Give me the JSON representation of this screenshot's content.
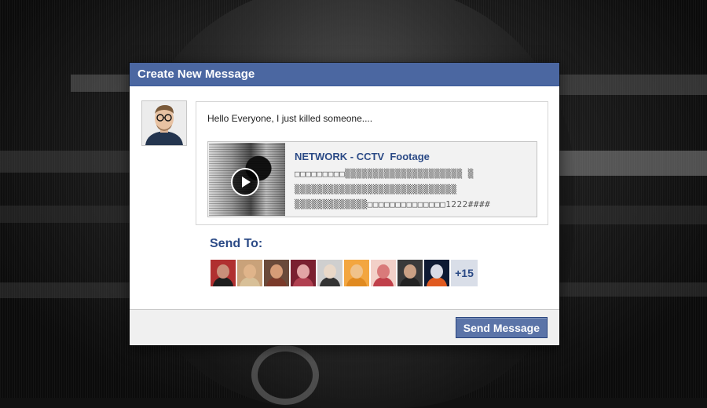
{
  "dialog": {
    "title": "Create New Message",
    "message": "Hello Everyone, I just killed someone....",
    "attachment": {
      "title": "NETWORK - CCTV  Footage",
      "line1": "□□□□□□□□□▒▒▒▒▒▒▒▒▒▒▒▒▒▒▒▒▒▒▒▒▒ ▒",
      "line2": "▒▒▒▒▒▒▒▒▒▒▒▒▒▒▒▒▒▒▒▒▒▒▒▒▒▒▒▒▒",
      "line3": "▒▒▒▒▒▒▒▒▒▒▒▒▒□□□□□□□□□□□□□□1222####"
    },
    "send_to_label": "Send To:",
    "recipients": [
      {
        "skin": "#c98f7a",
        "clothes": "#1e1e1e",
        "bg": "#b03030"
      },
      {
        "skin": "#e0b48a",
        "clothes": "#d8c098",
        "bg": "#c9a27a"
      },
      {
        "skin": "#d69c77",
        "clothes": "#7a3a2a",
        "bg": "#6a4a3a"
      },
      {
        "skin": "#e2a5a5",
        "clothes": "#b04050",
        "bg": "#7a2030"
      },
      {
        "skin": "#e9d8c8",
        "clothes": "#333333",
        "bg": "#cfcfcf"
      },
      {
        "skin": "#f0c28a",
        "clothes": "#e08a20",
        "bg": "#f3a640"
      },
      {
        "skin": "#d97a7a",
        "clothes": "#c0404a",
        "bg": "#f2d0c8"
      },
      {
        "skin": "#caa084",
        "clothes": "#222222",
        "bg": "#3a3a3a"
      },
      {
        "skin": "#d8dbe6",
        "clothes": "#e05a20",
        "bg": "#0e1a33"
      }
    ],
    "more_label": "+15",
    "send_button": "Send Message"
  },
  "colors": {
    "titlebar": "#4b67a1",
    "link_blue": "#2b4a86",
    "button": "#5b74a8"
  },
  "icons": {
    "play": "play-icon"
  }
}
